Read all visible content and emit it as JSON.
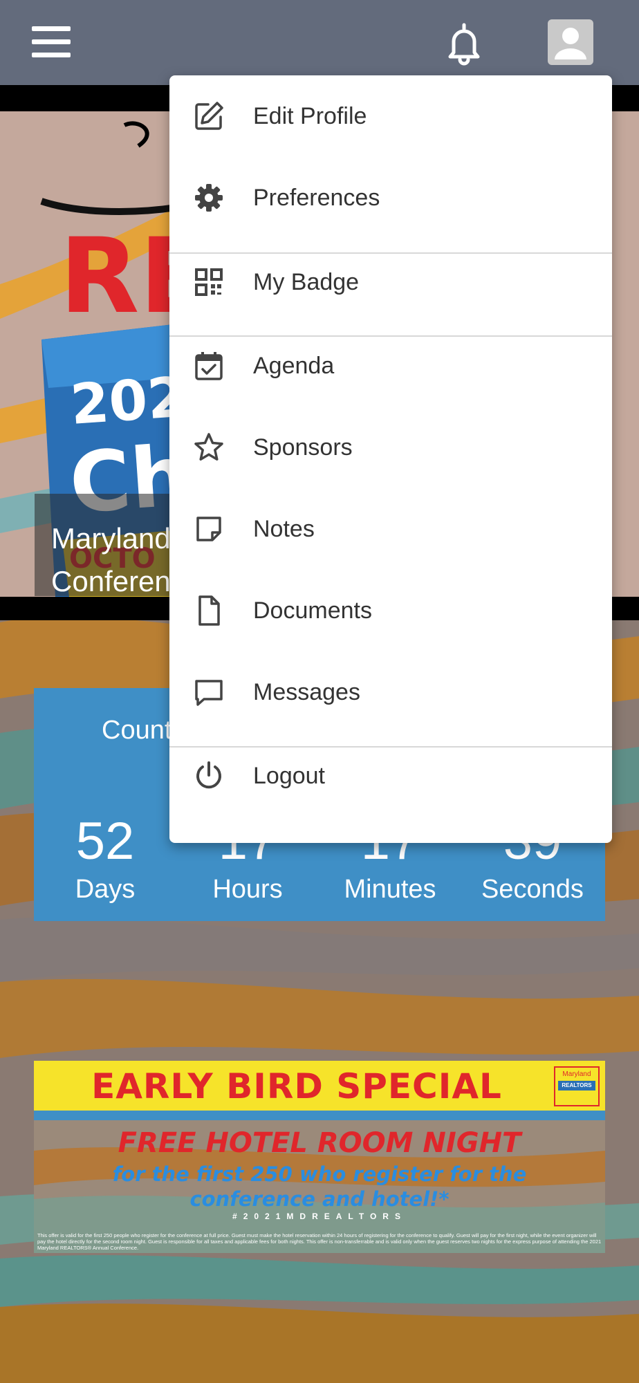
{
  "header": {
    "menu_icon": "hamburger-menu-icon",
    "notifications_icon": "bell-icon",
    "profile_icon": "user-avatar-icon"
  },
  "hero": {
    "caption_line1": "Maryland",
    "caption_line2": "Conferen"
  },
  "countdown": {
    "title": "Count",
    "units": [
      {
        "value": "52",
        "label": "Days"
      },
      {
        "value": "17",
        "label": "Hours"
      },
      {
        "value": "17",
        "label": "Minutes"
      },
      {
        "value": "39",
        "label": "Seconds"
      }
    ]
  },
  "promo": {
    "title": "EARLY BIRD SPECIAL",
    "headline": "FREE HOTEL ROOM NIGHT",
    "subline1": "for the first 250 who register for the",
    "subline2": "conference and hotel!*",
    "hashtag": "#2021MDREALTORS",
    "logo_line1": "Maryland",
    "logo_line2": "REALTORS",
    "fine_print": "This offer is valid for the first 250 people who register for the conference at full price. Guest must make the hotel reservation within 24 hours of registering for the conference to qualify. Guest will pay for the first night, while the event organizer will pay the hotel directly for the second room night. Guest is responsible for all taxes and applicable fees for both nights. This offer is non-transferrable and is valid only when the guest reserves two nights for the express purpose of attending the 2021 Maryland REALTORS® Annual Conference."
  },
  "menu": {
    "items": [
      {
        "label": "Edit Profile",
        "icon": "edit-icon"
      },
      {
        "label": "Preferences",
        "icon": "gear-icon"
      },
      {
        "label": "My Badge",
        "icon": "qr-code-icon"
      },
      {
        "label": "Agenda",
        "icon": "calendar-check-icon"
      },
      {
        "label": "Sponsors",
        "icon": "star-icon"
      },
      {
        "label": "Notes",
        "icon": "sticky-note-icon"
      },
      {
        "label": "Documents",
        "icon": "document-icon"
      },
      {
        "label": "Messages",
        "icon": "message-icon"
      },
      {
        "label": "Logout",
        "icon": "power-icon"
      }
    ]
  },
  "colors": {
    "header_bg": "#636b7c",
    "countdown_bg": "#3f8fc6",
    "promo_yellow": "#f6e32a",
    "promo_red": "#e0262b",
    "menu_text": "#333333"
  }
}
